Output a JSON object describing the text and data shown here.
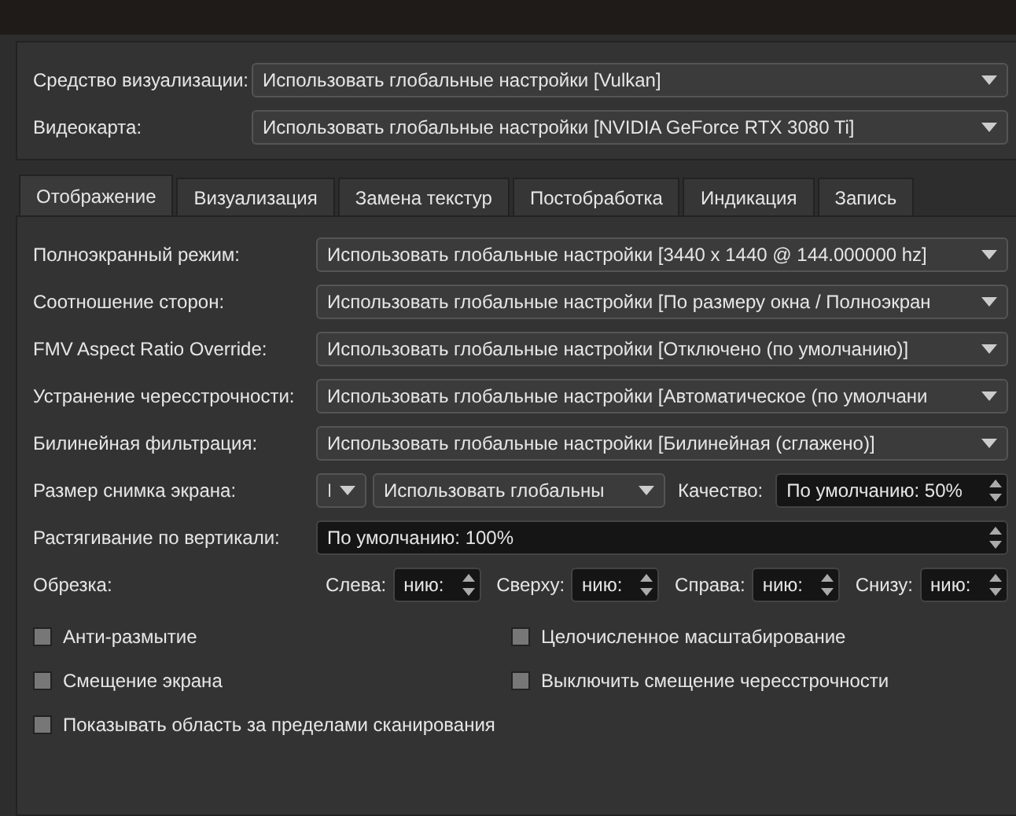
{
  "general": [
    {
      "label": "Средство визуализации:",
      "value": "Использовать глобальные настройки [Vulkan]"
    },
    {
      "label": "Видеокарта:",
      "value": "Использовать глобальные настройки [NVIDIA GeForce RTX 3080 Ti]"
    }
  ],
  "tabs": [
    {
      "label": "Отображение",
      "selected": true
    },
    {
      "label": "Визуализация",
      "selected": false
    },
    {
      "label": "Замена текстур",
      "selected": false
    },
    {
      "label": "Постобработка",
      "selected": false
    },
    {
      "label": "Индикация",
      "selected": false
    },
    {
      "label": "Запись",
      "selected": false
    }
  ],
  "settings": [
    {
      "kind": "combo",
      "label": "Полноэкранный режим:",
      "value": "Использовать глобальные настройки [3440 x 1440 @ 144.000000 hz]"
    },
    {
      "kind": "combo",
      "label": "Соотношение сторон:",
      "value": "Использовать глобальные настройки [По размеру окна / Полноэкран"
    },
    {
      "kind": "combo",
      "label": "FMV Aspect Ratio Override:",
      "value": "Использовать глобальные настройки [Отключено (по умолчанию)]"
    },
    {
      "kind": "combo",
      "label": "Устранение чересстрочности:",
      "value": "Использовать глобальные настройки [Автоматическое (по умолчани"
    },
    {
      "kind": "combo",
      "label": "Билинейная фильтрация:",
      "value": "Использовать глобальные настройки [Билинейная (сглажено)]"
    },
    {
      "kind": "screenshot",
      "label": "Размер снимка экрана:",
      "size": "I",
      "format": "Использовать глобальны",
      "quality_label": "Качество:",
      "quality": "По умолчанию: 50%"
    },
    {
      "kind": "spin",
      "label": "Растягивание по вертикали:",
      "value": "По умолчанию: 100%"
    },
    {
      "kind": "crop",
      "label": "Обрезка:",
      "fields": [
        {
          "label": "Слева:",
          "value": "нию:"
        },
        {
          "label": "Сверху:",
          "value": "нию:"
        },
        {
          "label": "Справа:",
          "value": "нию:"
        },
        {
          "label": "Снизу:",
          "value": "нию:"
        }
      ]
    }
  ],
  "checkboxes": [
    {
      "label": "Анти-размытие",
      "checked": false
    },
    {
      "label": "Целочисленное масштабирование",
      "checked": false
    },
    {
      "label": "Смещение экрана",
      "checked": false
    },
    {
      "label": "Выключить смещение чересстрочности",
      "checked": false
    },
    {
      "label": "Показывать область за пределами сканирования",
      "checked": false
    }
  ]
}
